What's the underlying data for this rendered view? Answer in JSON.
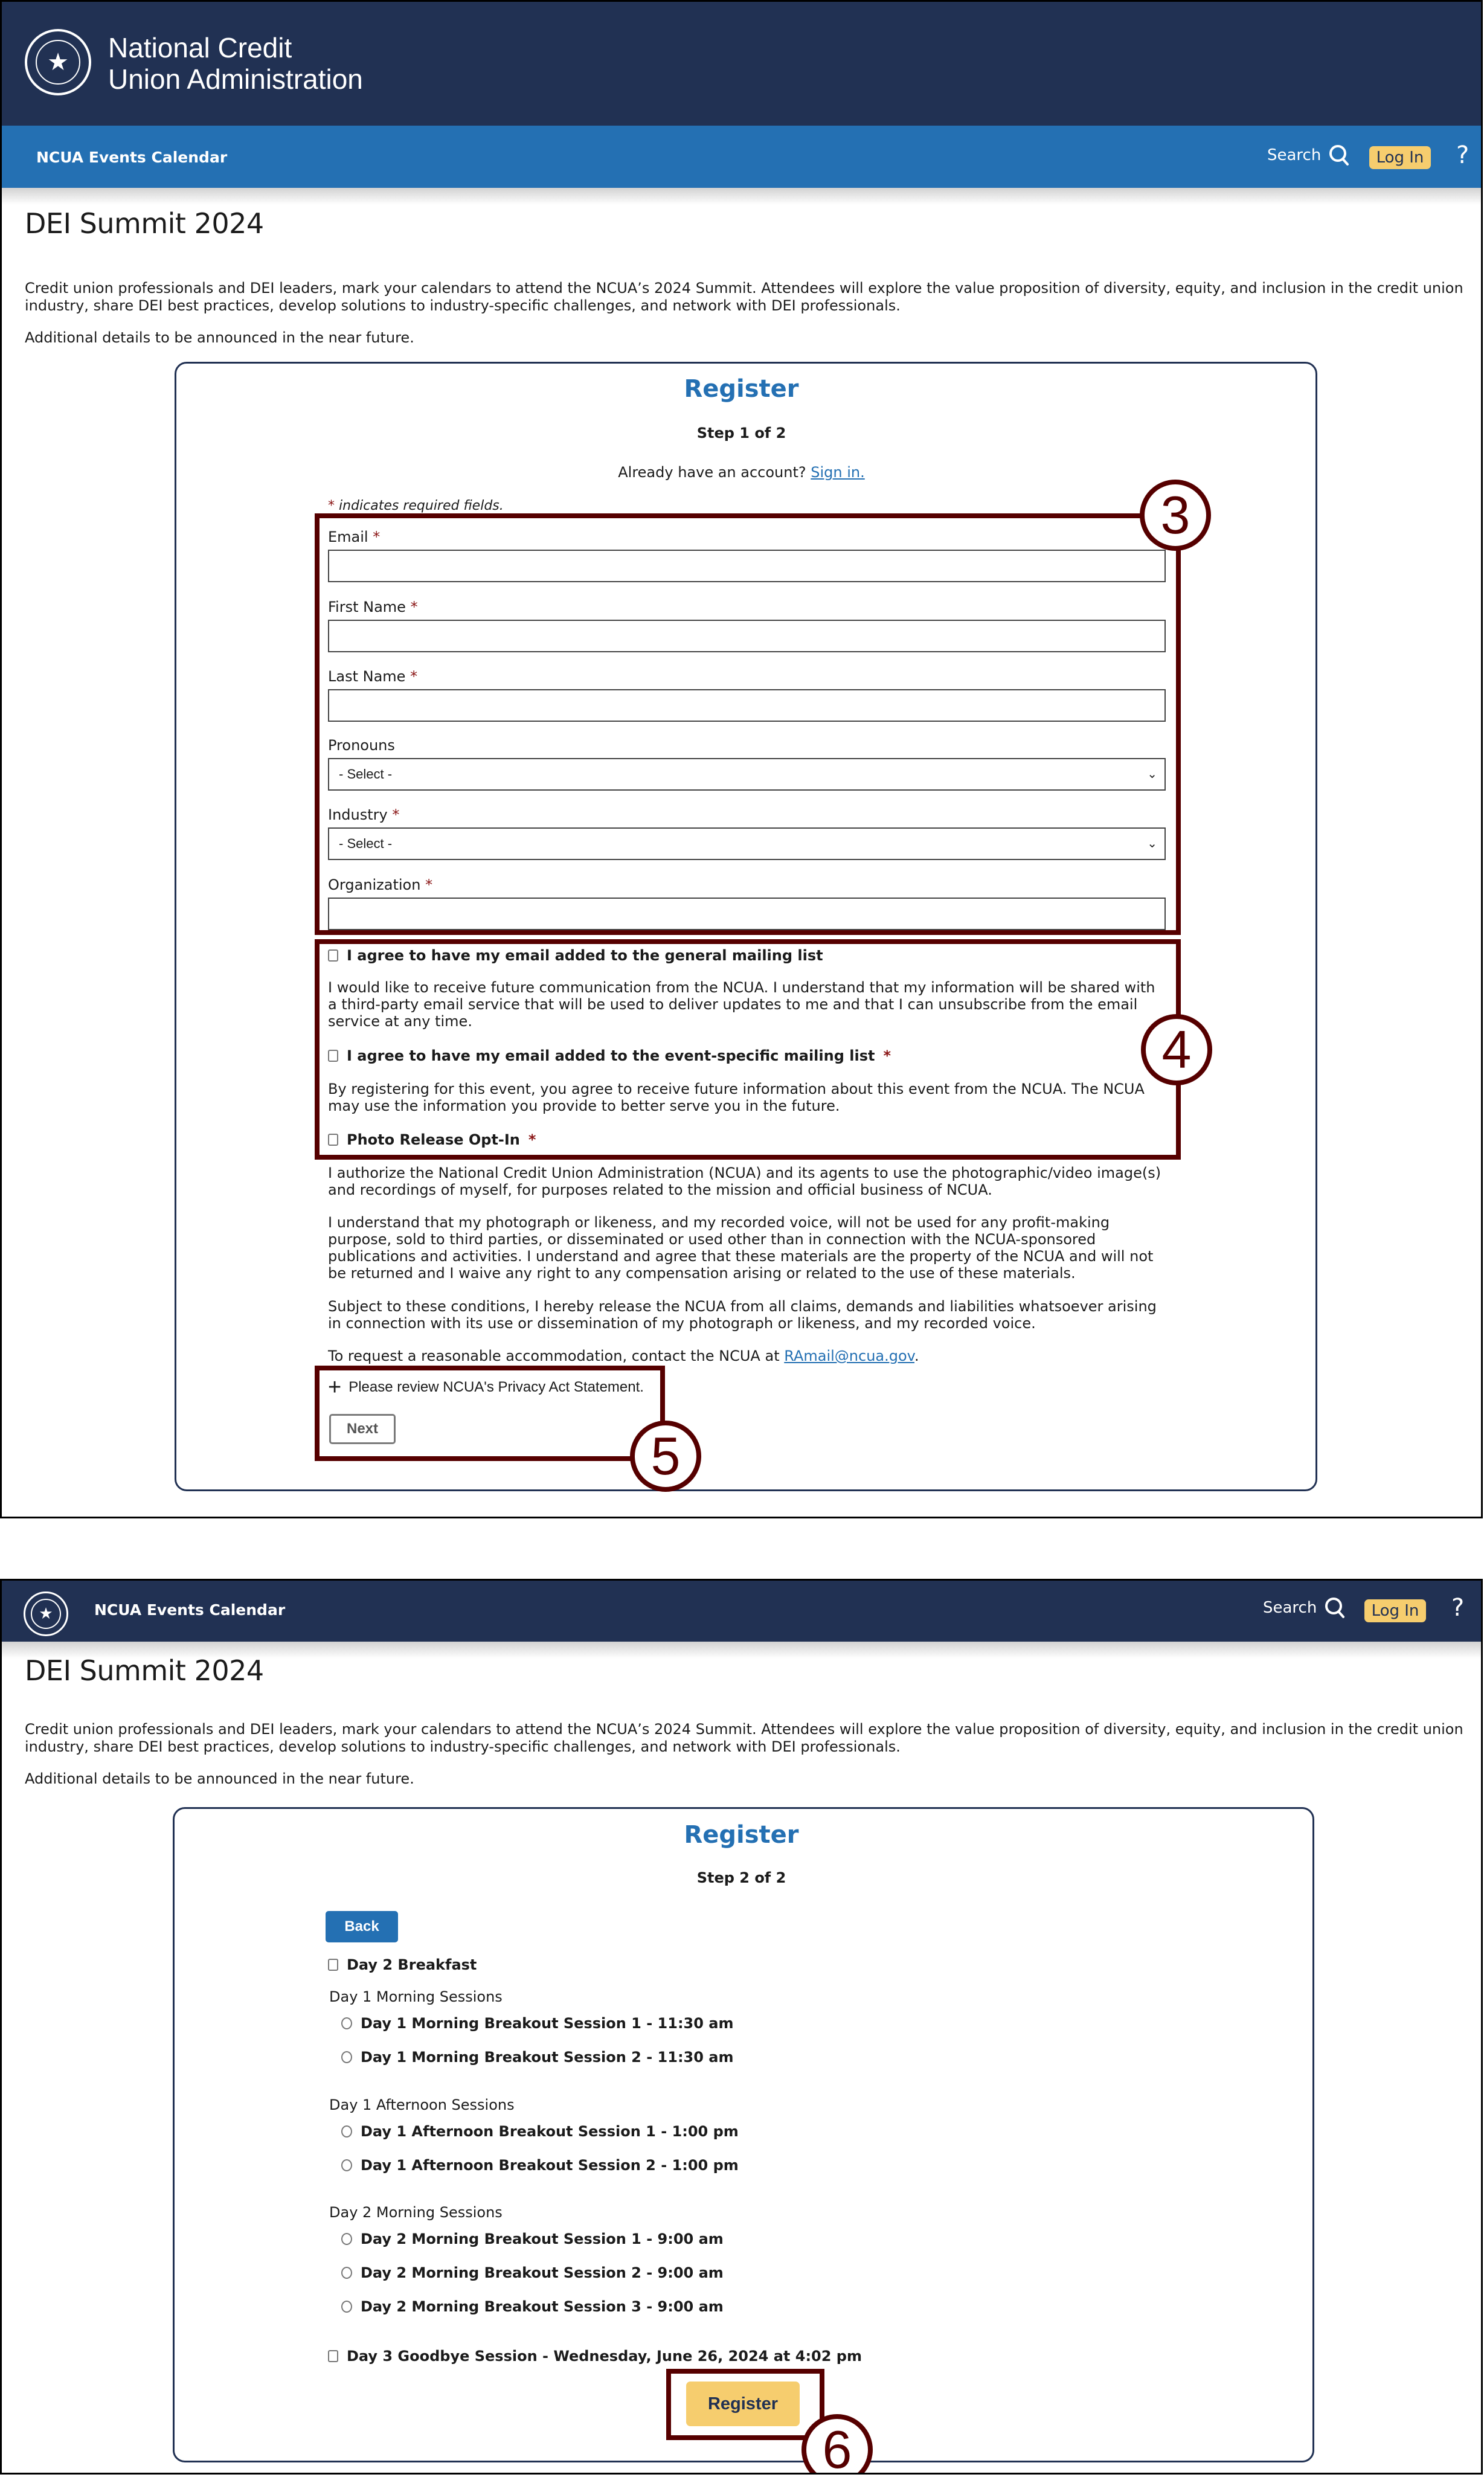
{
  "header": {
    "org_name_line1": "National Credit",
    "org_name_line2": "Union Administration",
    "nav_title": "NCUA Events Calendar",
    "search_label": "Search",
    "login_label": "Log In",
    "help_label": "?",
    "logo_icon": "ncua-seal-icon",
    "colors": {
      "brand_navy": "#213153",
      "nav_blue": "#2470b3",
      "login_gold": "#f6cd6e"
    }
  },
  "event": {
    "title": "DEI Summit 2024",
    "description": "Credit union professionals and DEI leaders, mark your calendars to attend the NCUA’s 2024 Summit. Attendees will explore the value proposition of diversity, equity, and inclusion in the credit union industry, share DEI best practices, develop solutions to industry-specific challenges, and network with DEI professionals.",
    "additional": "Additional details to be announced in the near future."
  },
  "step1": {
    "title": "Register",
    "step": "Step 1 of 2",
    "signin_prompt": "Already have an account?",
    "signin_link": "Sign in.",
    "required_note": "indicates required fields.",
    "required_mark": "*",
    "fields": [
      {
        "label": "Email",
        "required": true,
        "type": "text",
        "value": ""
      },
      {
        "label": "First Name",
        "required": true,
        "type": "text",
        "value": ""
      },
      {
        "label": "Last Name",
        "required": true,
        "type": "text",
        "value": ""
      },
      {
        "label": "Pronouns",
        "required": false,
        "type": "select",
        "value": "- Select -"
      },
      {
        "label": "Industry",
        "required": true,
        "type": "select",
        "value": "- Select -"
      },
      {
        "label": "Organization",
        "required": true,
        "type": "text",
        "value": ""
      }
    ],
    "consents": [
      {
        "label": "I agree to have my email added to the general mailing list",
        "required": false,
        "checked": false,
        "text": "I would like to receive future communication from the NCUA. I understand that my information will be shared with a third-party email service that will be used to deliver updates to me and that I can unsubscribe from the email service at any time."
      },
      {
        "label": "I agree to have my email added to the event-specific mailing list",
        "required": true,
        "checked": false,
        "text": "By registering for this event, you agree to receive future information about this event from the NCUA. The NCUA may use the information you provide to better serve you in the future."
      },
      {
        "label": "Photo Release Opt-In",
        "required": true,
        "checked": false
      }
    ],
    "photo_release": [
      "I authorize the National Credit Union Administration (NCUA) and its agents to use the photographic/video image(s) and recordings of myself, for purposes related to the mission and official business of NCUA.",
      "I understand that my photograph or likeness, and my recorded voice, will not be used for any profit-making purpose, sold to third parties, or disseminated or used other than in connection with the NCUA-sponsored publications and activities. I understand and agree that these materials are the property of the NCUA and will not be returned and I waive any right to any compensation arising or related to the use of these materials.",
      "Subject to these conditions, I hereby release the NCUA from all claims, demands and liabilities whatsoever arising in connection with its use or dissemination of my photograph or likeness, and my recorded voice."
    ],
    "accommodation_prefix": "To request a reasonable accommodation, contact the NCUA at",
    "accommodation_email": "RAmail@ncua.gov",
    "accommodation_suffix": ".",
    "privacy_toggle": "Please review NCUA's Privacy Act Statement.",
    "next_label": "Next"
  },
  "step2": {
    "title": "Register",
    "step": "Step 2 of 2",
    "back_label": "Back",
    "breakfast": {
      "label": "Day 2 Breakfast",
      "checked": false
    },
    "groups": [
      {
        "label": "Day 1 Morning Sessions",
        "options": [
          {
            "label": "Day 1 Morning Breakout Session 1 - 11:30 am",
            "selected": false
          },
          {
            "label": "Day 1 Morning Breakout Session 2 - 11:30 am",
            "selected": false
          }
        ]
      },
      {
        "label": "Day 1 Afternoon Sessions",
        "options": [
          {
            "label": "Day 1 Afternoon Breakout Session 1 - 1:00 pm",
            "selected": false
          },
          {
            "label": "Day 1 Afternoon Breakout Session 2 - 1:00 pm",
            "selected": false
          }
        ]
      },
      {
        "label": "Day 2 Morning Sessions",
        "options": [
          {
            "label": "Day 2 Morning Breakout Session 1 - 9:00 am",
            "selected": false
          },
          {
            "label": "Day 2 Morning Breakout Session 2 - 9:00 am",
            "selected": false
          },
          {
            "label": "Day 2 Morning Breakout Session 3 - 9:00 am",
            "selected": false
          }
        ]
      }
    ],
    "goodbye": {
      "label": "Day 3 Goodbye Session - Wednesday, June 26, 2024 at 4:02 pm",
      "checked": false
    },
    "register_label": "Register"
  },
  "annotations": [
    "3",
    "4",
    "5",
    "6"
  ]
}
